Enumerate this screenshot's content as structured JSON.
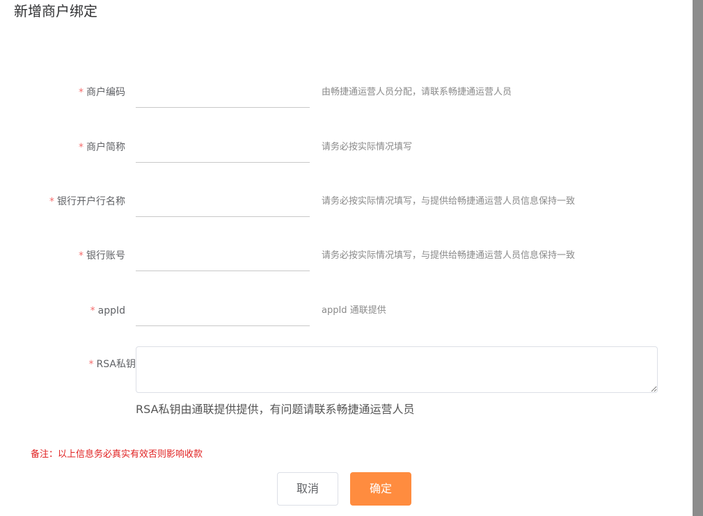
{
  "dialog": {
    "title": "新增商户绑定"
  },
  "form": {
    "required_mark": "*",
    "fields": [
      {
        "label": "商户编码",
        "value": "",
        "hint": "由畅捷通运营人员分配，请联系畅捷通运营人员"
      },
      {
        "label": "商户简称",
        "value": "",
        "hint": "请务必按实际情况填写"
      },
      {
        "label": "银行开户行名称",
        "value": "",
        "hint": "请务必按实际情况填写，与提供给畅捷通运营人员信息保持一致"
      },
      {
        "label": "银行账号",
        "value": "",
        "hint": "请务必按实际情况填写，与提供给畅捷通运营人员信息保持一致"
      },
      {
        "label": "appId",
        "value": "",
        "hint": "appId 通联提供"
      }
    ],
    "rsa": {
      "label": "RSA私钥",
      "value": "",
      "hint": "RSA私钥由通联提供提供，有问题请联系畅捷通运营人员"
    }
  },
  "remark": "备注：以上信息务必真实有效否则影响收款",
  "buttons": {
    "cancel": "取消",
    "confirm": "确定"
  },
  "colors": {
    "accent": "#ff8c3f",
    "required": "#f56c6c",
    "remark": "#e02020"
  }
}
